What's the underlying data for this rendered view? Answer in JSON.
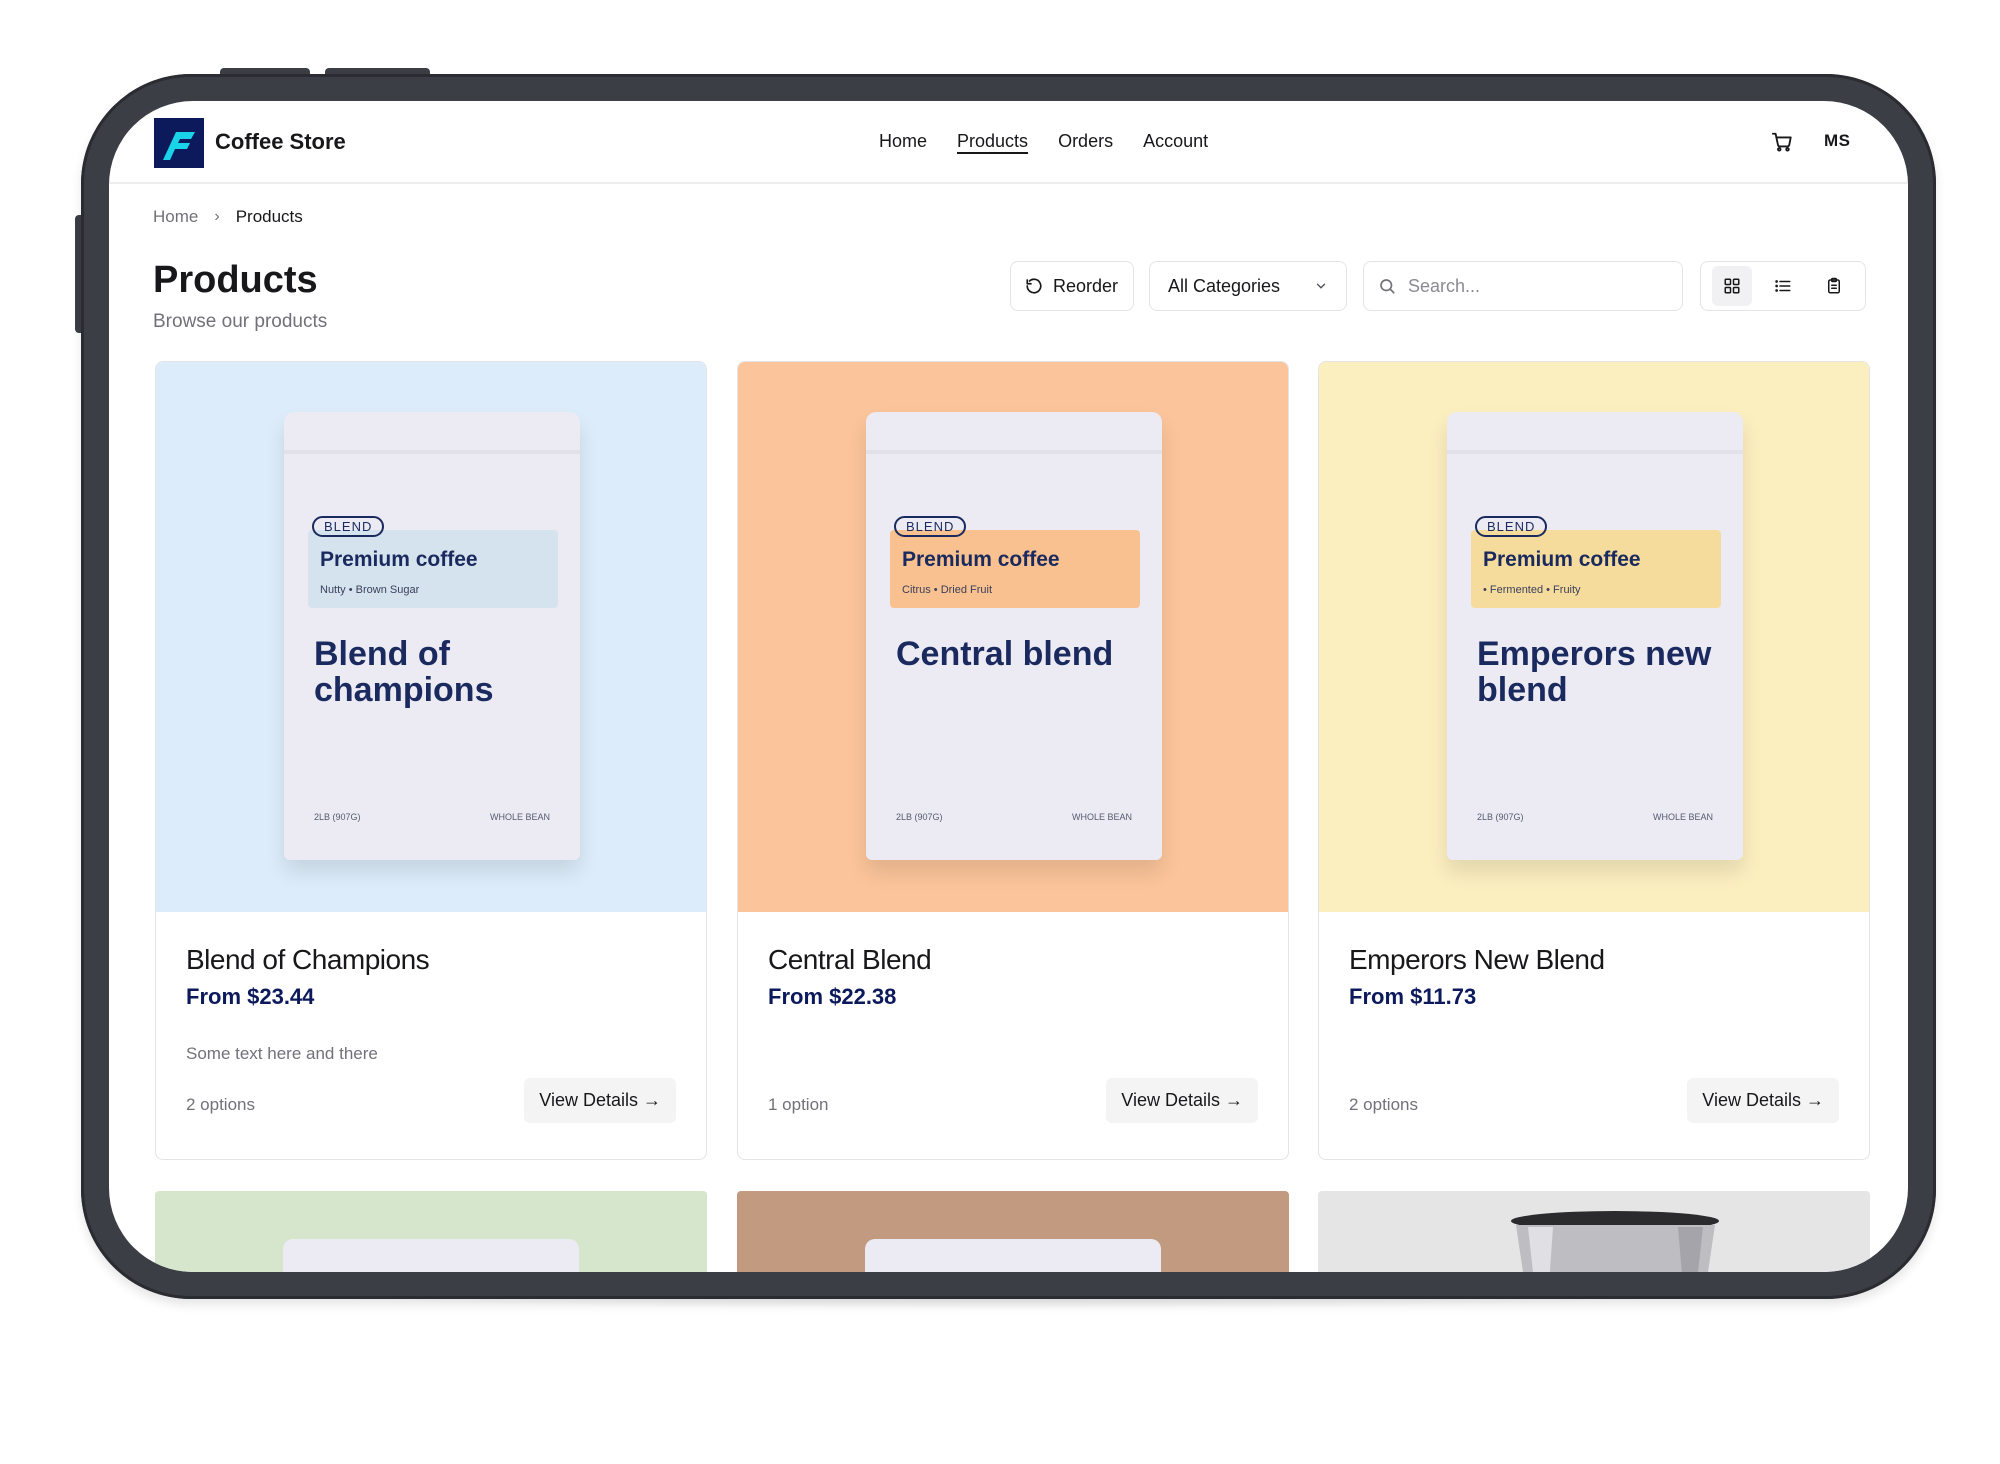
{
  "header": {
    "brand": "Coffee Store",
    "nav": [
      "Home",
      "Products",
      "Orders",
      "Account"
    ],
    "active_nav": "Products",
    "avatar_initials": "MS"
  },
  "breadcrumb": [
    "Home",
    "Products"
  ],
  "page": {
    "title": "Products",
    "subtitle": "Browse our products"
  },
  "toolbar": {
    "reorder_label": "Reorder",
    "category_selected": "All Categories",
    "search_placeholder": "Search...",
    "views": [
      "grid-icon",
      "list-icon",
      "clipboard-icon"
    ],
    "active_view": "grid-icon"
  },
  "products": [
    {
      "name": "Blend of Champions",
      "price": "From $23.44",
      "description": "Some text here and there",
      "options": "2 options",
      "button": "View Details →",
      "bag": {
        "tag": "BLEND",
        "label": "Premium coffee",
        "notes": "Nutty • Brown Sugar",
        "name": "Blend of champions",
        "weight": "2LB (907G)",
        "type": "WHOLE BEAN"
      },
      "bg": "#dcecfa",
      "label_bg": "#d5e3ef"
    },
    {
      "name": "Central Blend",
      "price": "From $22.38",
      "description": "",
      "options": "1 option",
      "button": "View Details →",
      "bag": {
        "tag": "BLEND",
        "label": "Premium coffee",
        "notes": "Citrus • Dried Fruit",
        "name": "Central blend",
        "weight": "2LB (907G)",
        "type": "WHOLE BEAN"
      },
      "bg": "#fbc49a",
      "label_bg": "#f8c18f"
    },
    {
      "name": "Emperors New Blend",
      "price": "From $11.73",
      "description": "",
      "options": "2 options",
      "button": "View Details →",
      "bag": {
        "tag": "BLEND",
        "label": "Premium coffee",
        "notes": "• Fermented • Fruity",
        "name": "Emperors new blend",
        "weight": "2LB (907G)",
        "type": "WHOLE BEAN"
      },
      "bg": "#fbeebf",
      "label_bg": "#f6dc9c"
    }
  ],
  "partial_row_colors": [
    "#d5e6cc",
    "#c19a80",
    "#e5e5e5"
  ],
  "colors": {
    "accent": "#0c1a5c",
    "logo_mark": "#19d3e8",
    "bag_text": "#1b2a5e"
  }
}
